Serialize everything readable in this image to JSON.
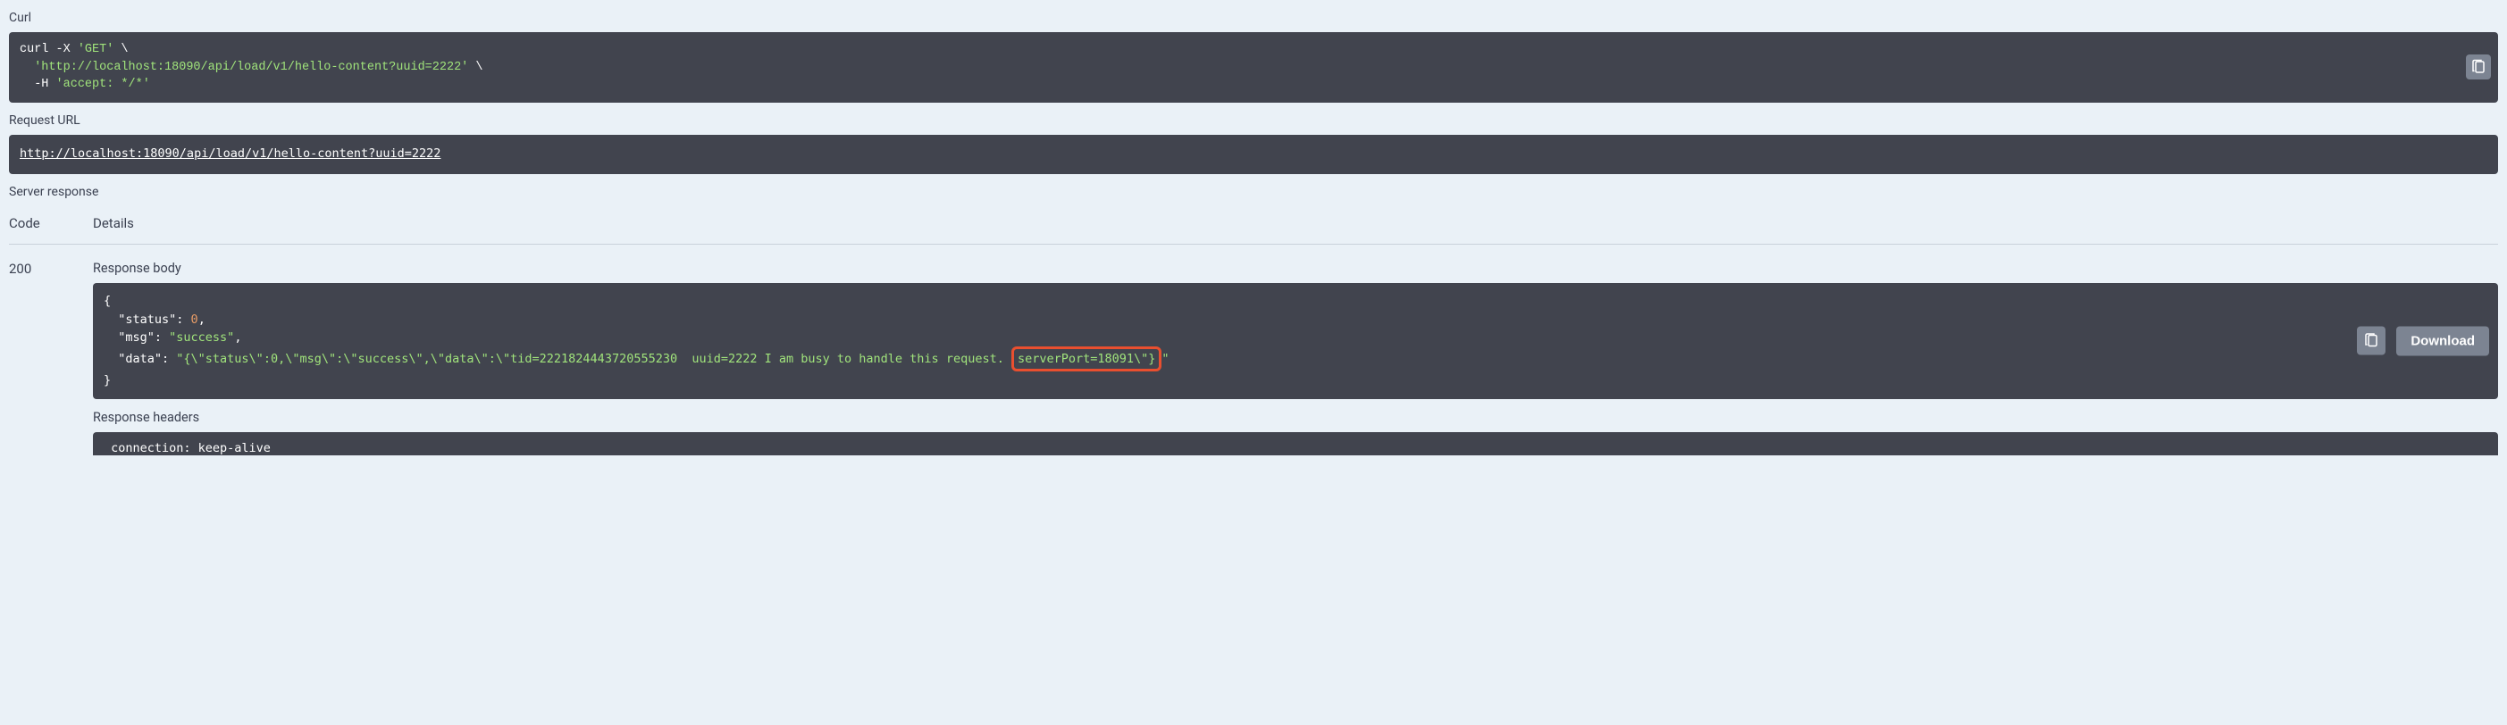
{
  "labels": {
    "curl": "Curl",
    "requestUrl": "Request URL",
    "serverResponse": "Server response",
    "code": "Code",
    "details": "Details",
    "responseBody": "Response body",
    "responseHeaders": "Response headers",
    "download": "Download"
  },
  "curl": {
    "line1a": "curl -X ",
    "line1b": "'GET'",
    "line1c": " \\",
    "line2a": "  ",
    "line2b": "'http://localhost:18090/api/load/v1/hello-content?uuid=2222'",
    "line2c": " \\",
    "line3a": "  -H ",
    "line3b": "'accept: */*'"
  },
  "requestUrl": "http://localhost:18090/api/load/v1/hello-content?uuid=2222",
  "response": {
    "statusCode": "200",
    "body": {
      "open": "{",
      "l1a": "  \"status\": ",
      "l1b": "0",
      "l1c": ",",
      "l2a": "  \"msg\": ",
      "l2b": "\"success\"",
      "l2c": ",",
      "l3a": "  \"data\": ",
      "l3b": "\"{\\\"status\\\":0,\\\"msg\\\":\\\"success\\\",\\\"data\\\":\\\"tid=2221824443720555230  uuid=2222 I am busy to handle this request. ",
      "l3hi": "serverPort=18091\\\"}",
      "l3d": "\"",
      "close": "}"
    },
    "headers": {
      "line1": " connection: keep-alive "
    }
  }
}
